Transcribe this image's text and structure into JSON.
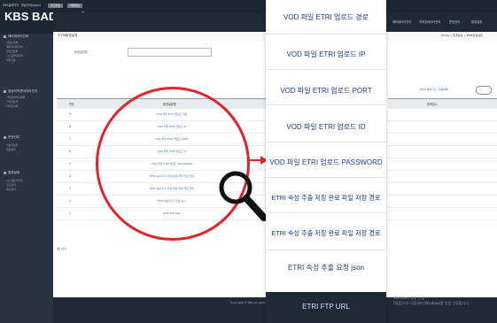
{
  "app": {
    "top_links": [
      "KBS홈페이지",
      "방송안내(apps)"
    ],
    "top_buttons": [
      "로그아웃",
      "회원정보"
    ],
    "logo": "KBS BADA Labs",
    "nav": [
      "메타데이터관리",
      "저작권데이터관리",
      "운영관리",
      "환경설정"
    ]
  },
  "sidebar": {
    "sections": [
      {
        "title": "메타데이터관리",
        "items": [
          "콘텐츠목록",
          "메타데이터검색",
          "콘텐츠등록",
          "시스템연계이력",
          "작업현황"
        ]
      },
      {
        "title": "방송저작권데이터관리",
        "items": [
          "저작권데이터목록",
          "저작권등록",
          "저작권검색"
        ]
      },
      {
        "title": "운영관리",
        "items": [
          "사용자관리",
          "권한관리"
        ]
      },
      {
        "title": "환경설정",
        "items": [
          "시스템환경설정",
          "코드관리",
          "메뉴관리"
        ]
      }
    ]
  },
  "page": {
    "title": "ETRI환경설정",
    "breadcrumb": "Home > 환경설정 > ETRI환경설정",
    "filter_label": "환경설정명",
    "table_headers": [
      "번호",
      "환경설정명"
    ],
    "row_numbers": [
      "9",
      "8",
      "7",
      "6",
      "5",
      "4",
      "3",
      "2",
      "1"
    ],
    "pager": "[총 9건]",
    "right_headers": [
      "등록일시"
    ],
    "toggle_label": "ETRI 속성 추출 사용여부",
    "footer_copyright": "Copyright © KBS All rights reserved."
  },
  "watermark": [
    "Windows 정품 인증",
    "[설정]으로 이동하여 Windows를 정품 인증합니다."
  ],
  "zoom_panel": {
    "labels": [
      "VOD 파일 ETRI 업로드 경로",
      "VOD 파일 ETRI 업로드 IP",
      "VOD 파일 ETRI 업로드 PORT",
      "VOD 파일 ETRI 업로드 ID",
      "VOD 파일 ETRI 업로드 PASSWORD",
      "ETRI 속성 추출 저장 완료 파일 저장 경로",
      "ETRI 속성 추출 저장 완료 파일 저장 경로",
      "ETRI 속성 추출 요청 json",
      "ETRI FTP URL"
    ]
  },
  "colors": {
    "highlight": "#e2232b",
    "zoom_text": "#1a3d8c",
    "dark": "#1f2a36"
  }
}
